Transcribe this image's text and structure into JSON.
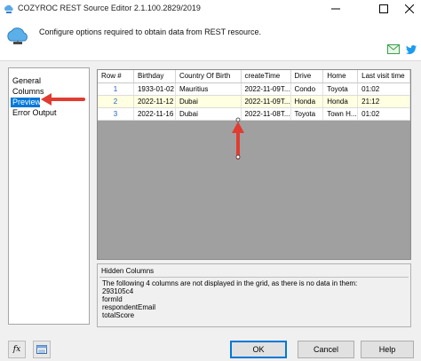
{
  "window": {
    "title": "COZYROC REST Source Editor 2.1.100.2829/2019",
    "icons": [
      "app-icon",
      "minimize-icon",
      "maximize-icon",
      "close-icon"
    ]
  },
  "header": {
    "description": "Configure options required to obtain data from REST resource.",
    "icons": [
      "cloud-icon",
      "mail-icon",
      "twitter-icon"
    ]
  },
  "nav": {
    "items": [
      {
        "label": "General"
      },
      {
        "label": "Columns"
      },
      {
        "label": "Preview",
        "selected": true
      },
      {
        "label": "Error Output"
      }
    ]
  },
  "grid": {
    "columns": [
      "Row #",
      "Birthday",
      "Country Of Birth",
      "createTime",
      "Drive",
      "Home",
      "Last visit time"
    ],
    "rows": [
      [
        "1",
        "1933-01-02",
        "Mauritius",
        "2022-11-09T...",
        "Condo",
        "Toyota",
        "01:02"
      ],
      [
        "2",
        "2022-11-12",
        "Dubai",
        "2022-11-09T...",
        "Honda",
        "Honda",
        "21:12"
      ],
      [
        "3",
        "2022-11-16",
        "Dubai",
        "2022-11-08T...",
        "Toyota",
        "Town H...",
        "01:02"
      ]
    ],
    "highlight_row": 1
  },
  "hidden_columns": {
    "title": "Hidden Columns",
    "lines": [
      "The following 4 columns are not displayed in the grid, as there is no data in them:",
      "293105c4",
      "formId",
      "respondentEmail",
      "totalScore"
    ]
  },
  "footer": {
    "fx_label": "fx",
    "ok": "OK",
    "cancel": "Cancel",
    "help": "Help",
    "icons": [
      "fx-icon",
      "variables-icon"
    ]
  },
  "colors": {
    "selection": "#0078d7",
    "annotation_arrow": "#e03c31",
    "grid_background": "#a0a0a0",
    "highlight_row": "#ffffe1"
  }
}
